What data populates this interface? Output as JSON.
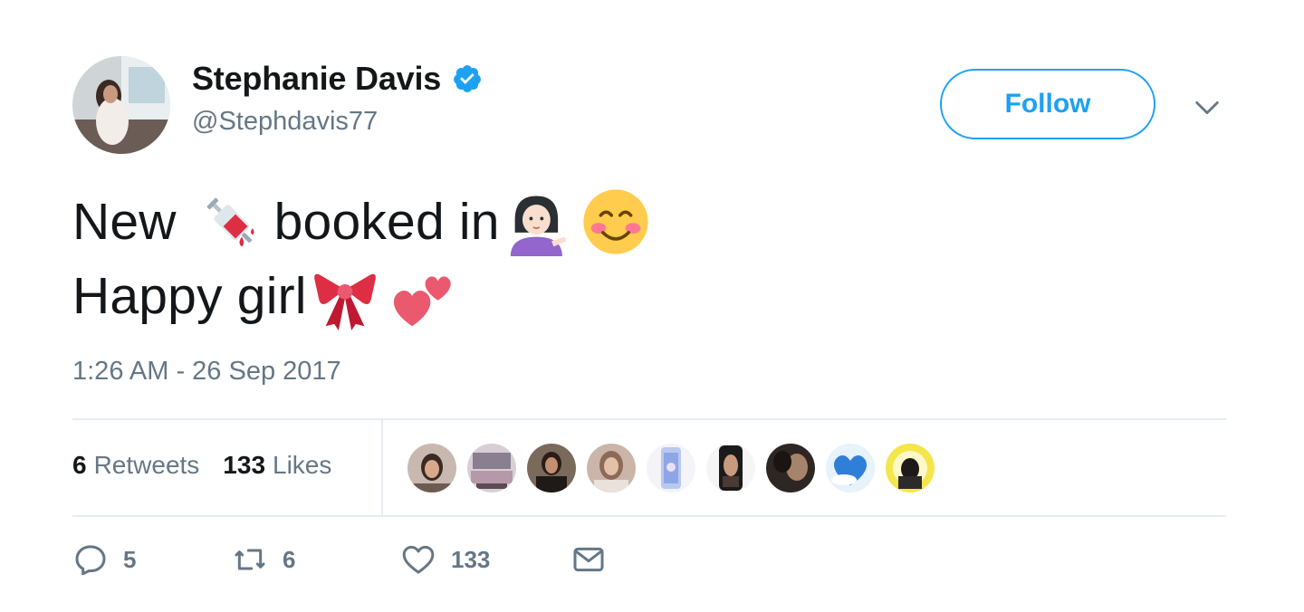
{
  "author": {
    "name": "Stephanie Davis",
    "handle": "@Stephdavis77",
    "verified": true,
    "avatar_icon": "avatar-photo"
  },
  "header": {
    "follow_label": "Follow",
    "menu_icon": "chevron-down-icon"
  },
  "tweet": {
    "line1_part1": "New",
    "line1_part2": "booked in",
    "line2_part1": "Happy girl",
    "emojis": [
      "syringe-emoji",
      "woman-tipping-hand-emoji",
      "smiling-face-emoji",
      "ribbon-emoji",
      "two-hearts-emoji"
    ],
    "timestamp": "1:26 AM - 26 Sep 2017"
  },
  "stats": {
    "retweets_count": "6",
    "retweets_label": "Retweets",
    "likes_count": "133",
    "likes_label": "Likes",
    "likers_count": 9
  },
  "actions": {
    "reply_count": "5",
    "retweet_count": "6",
    "like_count": "133",
    "reply_icon": "reply-icon",
    "retweet_icon": "retweet-icon",
    "like_icon": "heart-icon",
    "dm_icon": "envelope-icon"
  },
  "colors": {
    "accent": "#1da1f2",
    "text": "#14171a",
    "muted": "#657786",
    "divider": "#e6ecf0"
  }
}
